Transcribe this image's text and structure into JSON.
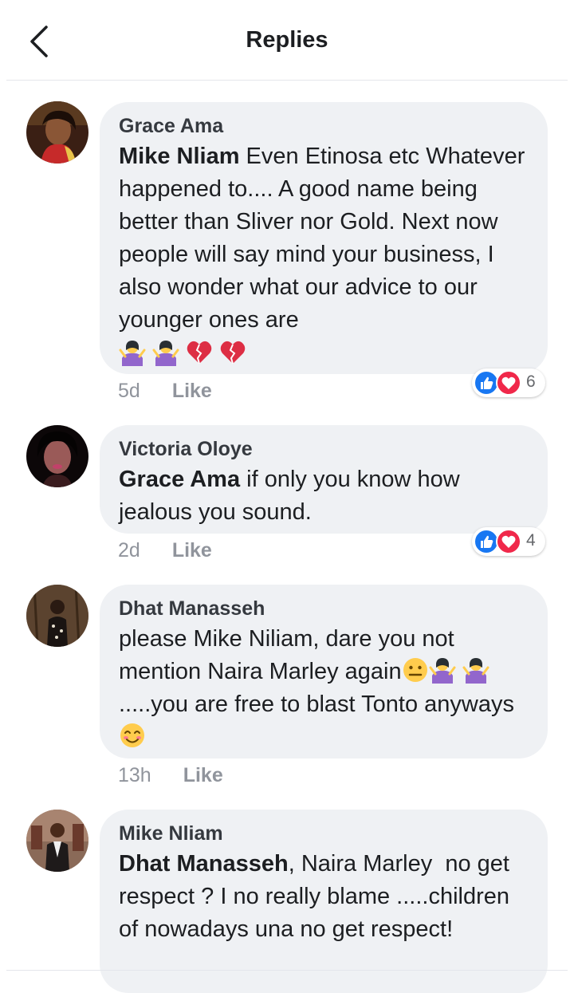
{
  "header": {
    "title": "Replies"
  },
  "comments": [
    {
      "author": "Grace Ama",
      "mention": "Mike Nliam",
      "text_line1": " Even Etinosa etc",
      "text_rest": "Whatever happened to.... A good name being better than Sliver nor Gold. Next now people will say mind your business, I also wonder what our advice to our younger ones are",
      "emojis": [
        "person-shrugging-emoji",
        "person-shrugging-emoji",
        "broken-heart-emoji",
        "broken-heart-emoji"
      ],
      "time": "5d",
      "like_label": "Like",
      "reaction_count": "6"
    },
    {
      "author": "Victoria Oloye",
      "mention": "Grace Ama",
      "text": " if only you know how jealous you sound.",
      "time": "2d",
      "like_label": "Like",
      "reaction_count": "4"
    },
    {
      "author": "Dhat Manasseh",
      "text_part1": "please Mike Niliam, dare you not mention Naira Marley again",
      "text_part2": ".....you are free to blast Tonto anyways",
      "time": "13h",
      "like_label": "Like"
    },
    {
      "author": "Mike Nliam",
      "mention": "Dhat Manasseh",
      "text": ", Naira Marley  no get respect ? I no really blame .....children of nowadays una no get respect!"
    }
  ],
  "colors": {
    "like_blue": "#1877f2",
    "love_red": "#f0284a",
    "bubble_bg": "#eff1f4",
    "meta_gray": "#90949c"
  }
}
